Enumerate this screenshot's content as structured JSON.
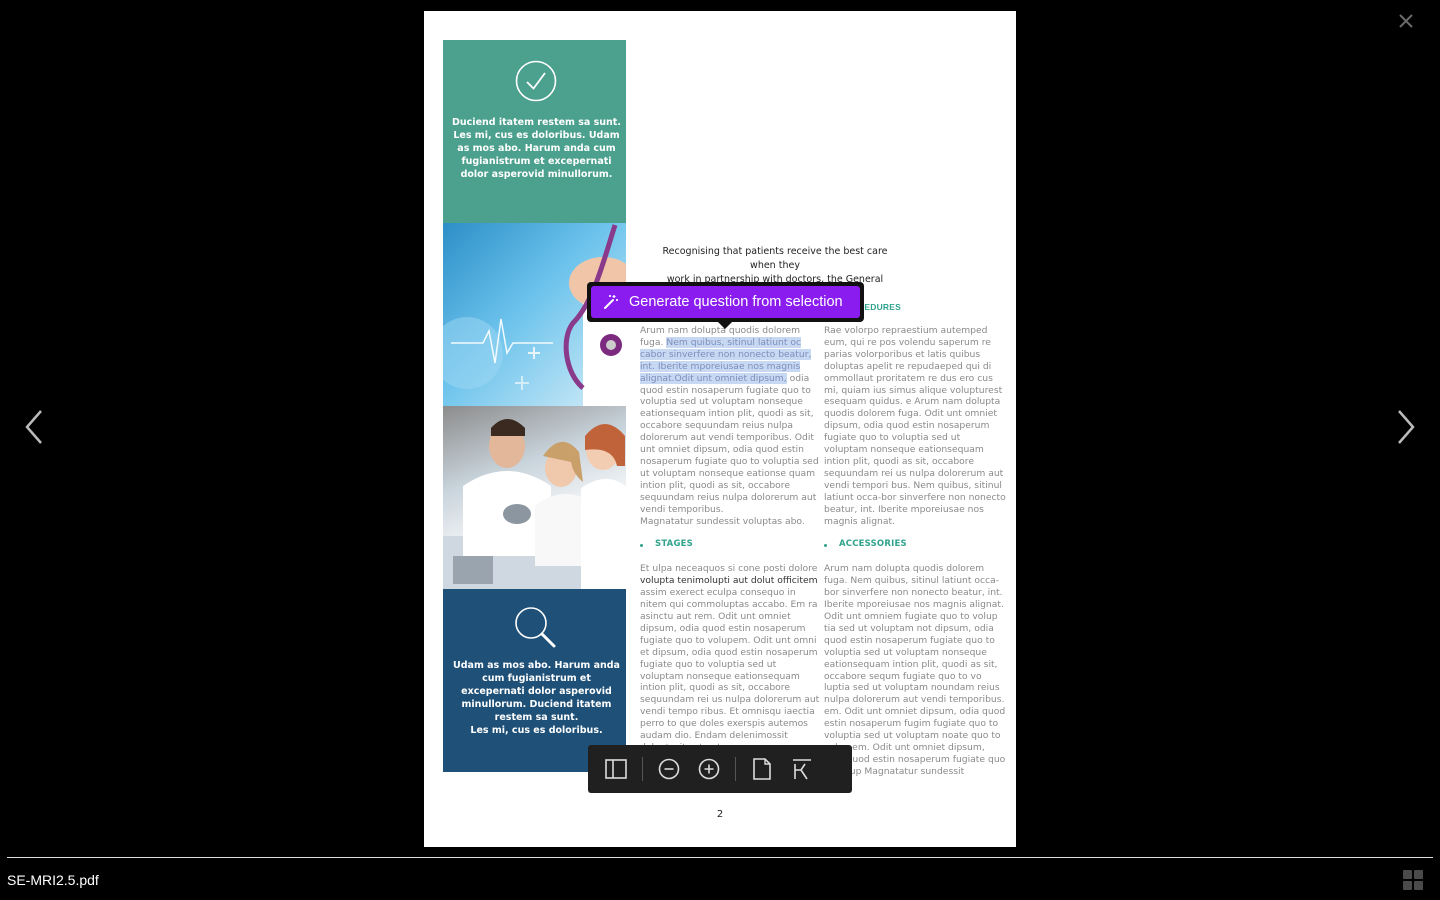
{
  "viewer": {
    "file_name": "SE-MRI2.5.pdf",
    "page_number": "2",
    "close_icon": "close-icon",
    "prev_icon": "chevron-left-icon",
    "next_icon": "chevron-right-icon"
  },
  "ai_popup": {
    "label": "Generate question from selection",
    "icon": "magic-wand-icon",
    "accent": "#8b1cf0"
  },
  "toolbar": {
    "items": [
      "sidebar-toggle-icon",
      "zoom-out-icon",
      "zoom-in-icon",
      "single-page-icon",
      "fit-width-icon"
    ]
  },
  "document": {
    "panel_top_text": "Duciend itatem restem sa sunt. Les mi, cus es doloribus. Udam as mos abo. Harum anda cum fugianistrum et excepernati dolor asperovid minullorum.",
    "panel_bottom_text_1": "Udam as mos abo. Harum anda cum fugianistrum et excepernati dolor asperovid minullorum. Duciend itatem restem sa sunt.",
    "panel_bottom_text_2": "Les mi, cus es doloribus.",
    "intro_1": "Recognising that patients receive the best care when they",
    "intro_2": "work in partnership with doctors, the General Medical",
    "procedures_heading": "PROCEDURES",
    "col_a_p1_before": "Arum nam dolupta quodis dolorem fuga. ",
    "col_a_p1_selected": "Nem quibus, sitinul latiunt oc cabor sinverfere non nonecto beatur, int. Iberite mporeiusae nos magnis alignat.Odit unt omniet dipsum,",
    "col_a_p1_after": " odia quod estin nosaperum fugiate quo to voluptia sed ut voluptam nonseque eationsequam intion plit, quodi as sit, occabore sequundam reius nulpa dolorerum aut vendi temporibus. Odit unt omniet dipsum, odia quod estin nosaperum fugiate quo to voluptia sed ut voluptam nonseque eationse quam intion plit, quodi as sit, occabore sequundam reius nulpa dolorerum aut vendi temporibus.",
    "col_a_p1_end": "Magnatatur sundessit voluptas abo.",
    "stages_heading": "STAGES",
    "col_a_p2_start": "Et ulpa neceaquos si cone posti dolore",
    "col_a_p2_dark": "volupta tenimolupti aut dolut officitem",
    "col_a_p2_rest": "assim exerect eculpa consequo in nitem qui commoluptas accabo. Em ra asinctu aut rem. Odit unt omniet dipsum, odia quod estin nosaperum fugiate quo to volupem. Odit unt omni et dipsum, odia quod estin nosaperum fugiate quo to voluptia sed ut voluptam nonseque eationsequam intion plit, quodi as sit, occabore sequundam rei us nulpa dolorerum aut vendi tempo ribus. Et omnisqu iaectia perro to que doles exerspis autemos audam dio. Endam delenimossit doluptasit est ant",
    "col_b_p1": "Rae volorpo repraestium autemped eum, qui re pos volendu saperum re parias volorporibus et latis quibus doluptas apelit re repudaeped qui di ommollaut proritatem re dus ero cus mi, quiam ius simus alique volupturest esequam quidus. e Arum nam dolupta quodis dolorem fuga. Odit unt omniet dipsum, odia quod estin nosaperum fugiate quo to voluptia sed ut voluptam nonseque eationsequam intion plit, quodi as sit, occabore sequundam rei us nulpa dolorerum aut vendi tempori bus. Nem quibus, sitinul latiunt occa-bor sinverfere non nonecto beatur, int. Iberite mporeiusae nos magnis alignat.",
    "accessories_heading": "ACCESSORIES",
    "col_b_p2": "Arum nam dolupta quodis dolorem fuga. Nem quibus, sitinul latiunt occa-bor sinverfere non nonecto beatur, int. Iberite mporeiusae nos magnis alignat. Odit unt omniem fugiate quo to volup tia sed ut voluptam not dipsum, odia quod estin nosaperum fugiate quo to voluptia sed ut voluptam nonseque eationsequam intion plit, quodi as sit, occabore sequm fugiate quo to vo luptia sed ut voluptam noundam reius nulpa dolorerum aut vendi temporibus. em. Odit unt omniet dipsum, odia quod estin nosaperum fugim fugiate quo to voluptia sed ut voluptam noate quo to volup em. Odit unt omniet dipsum, odia quod estin nosaperum fugiate quo to volup Magnatatur sundessit",
    "colors": {
      "teal": "#4ca08e",
      "navy": "#1f5078",
      "heading": "#2fa38c"
    }
  }
}
